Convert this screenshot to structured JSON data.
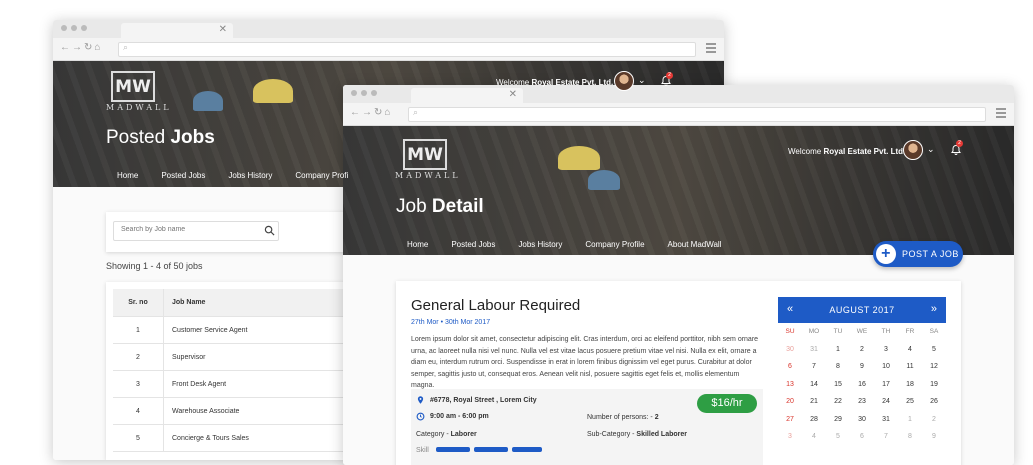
{
  "back": {
    "brand": {
      "mark": "MW",
      "name": "MADWALL"
    },
    "welcome_prefix": "Welcome",
    "welcome_company": "Royal Estate Pvt. Ltd.",
    "notification_count": "2",
    "title_light": "Posted",
    "title_bold": "Jobs",
    "nav": [
      "Home",
      "Posted Jobs",
      "Jobs History",
      "Company Profi"
    ],
    "search_placeholder": "Search by Job name",
    "showing": "Showing 1 - 4 of 50 jobs",
    "table": {
      "headers": [
        "Sr. no",
        "Job Name"
      ],
      "rows": [
        [
          "1",
          "Customer Service Agent"
        ],
        [
          "2",
          "Supervisor"
        ],
        [
          "3",
          "Front Desk Agent"
        ],
        [
          "4",
          "Warehouse Associate"
        ],
        [
          "5",
          "Concierge & Tours Sales"
        ]
      ]
    }
  },
  "front": {
    "brand": {
      "mark": "MW",
      "name": "MADWALL"
    },
    "welcome_prefix": "Welcome",
    "welcome_company": "Royal Estate Pvt. Ltd.",
    "notification_count": "2",
    "title_light": "Job",
    "title_bold": "Detail",
    "nav": [
      "Home",
      "Posted Jobs",
      "Jobs History",
      "Company Profile",
      "About MadWall"
    ],
    "post_button": "POST A JOB",
    "job": {
      "title": "General Labour Required",
      "dates": "27th Mor • 30th Mor 2017",
      "description": "Lorem ipsum dolor sit amet, consectetur adipiscing elit. Cras interdum, orci ac eleifend porttitor, nibh sem ornare urna, ac laoreet nulla nisi vel nunc. Nulla vel est vitae lacus posuere pretium vitae vel nisi. Nulla ex elit, ornare a diam eu, interdum rutrum orci. Suspendisse in erat in lorem finibus dignissim vel eget purus. Curabitur at dolor semper, sagittis justo ut, consequat eros. Aenean velit nisl, posuere sagittis eget felis et, mollis elementum magna.",
      "address": "#6778, Royal Street , Lorem City",
      "time": "9:00 am - 6:00 pm",
      "persons_label": "Number of persons: -",
      "persons_value": "2",
      "category_label": "Category -",
      "category_value": "Laborer",
      "subcategory_label": "Sub-Category -",
      "subcategory_value": "Skilled Laborer",
      "pay": "$16/hr",
      "skills_label": "Skill"
    },
    "calendar": {
      "month": "AUGUST 2017",
      "prev": "«",
      "next": "»",
      "weekdays": [
        "SU",
        "MO",
        "TU",
        "WE",
        "TH",
        "FR",
        "SA"
      ],
      "weeks": [
        [
          "30",
          "31",
          "1",
          "2",
          "3",
          "4",
          "5"
        ],
        [
          "6",
          "7",
          "8",
          "9",
          "10",
          "11",
          "12"
        ],
        [
          "13",
          "14",
          "15",
          "16",
          "17",
          "18",
          "19"
        ],
        [
          "20",
          "21",
          "22",
          "23",
          "24",
          "25",
          "26"
        ],
        [
          "27",
          "28",
          "29",
          "30",
          "31",
          "1",
          "2"
        ],
        [
          "3",
          "4",
          "5",
          "6",
          "7",
          "8",
          "9"
        ]
      ],
      "dim_cells": [
        "0-0",
        "0-1",
        "4-5",
        "4-6",
        "5-0",
        "5-1",
        "5-2",
        "5-3",
        "5-4",
        "5-5",
        "5-6"
      ]
    }
  },
  "colors": {
    "accent": "#1e5bc6",
    "pay_green": "#2e9e44",
    "sunday_red": "#d9342b",
    "badge_red": "#e53935"
  },
  "icons": [
    "search-icon",
    "location-pin-icon",
    "clock-icon",
    "bell-icon",
    "chevron-down-icon",
    "plus-icon",
    "menu-icon",
    "back-icon",
    "forward-icon",
    "refresh-icon",
    "home-icon",
    "close-icon"
  ]
}
